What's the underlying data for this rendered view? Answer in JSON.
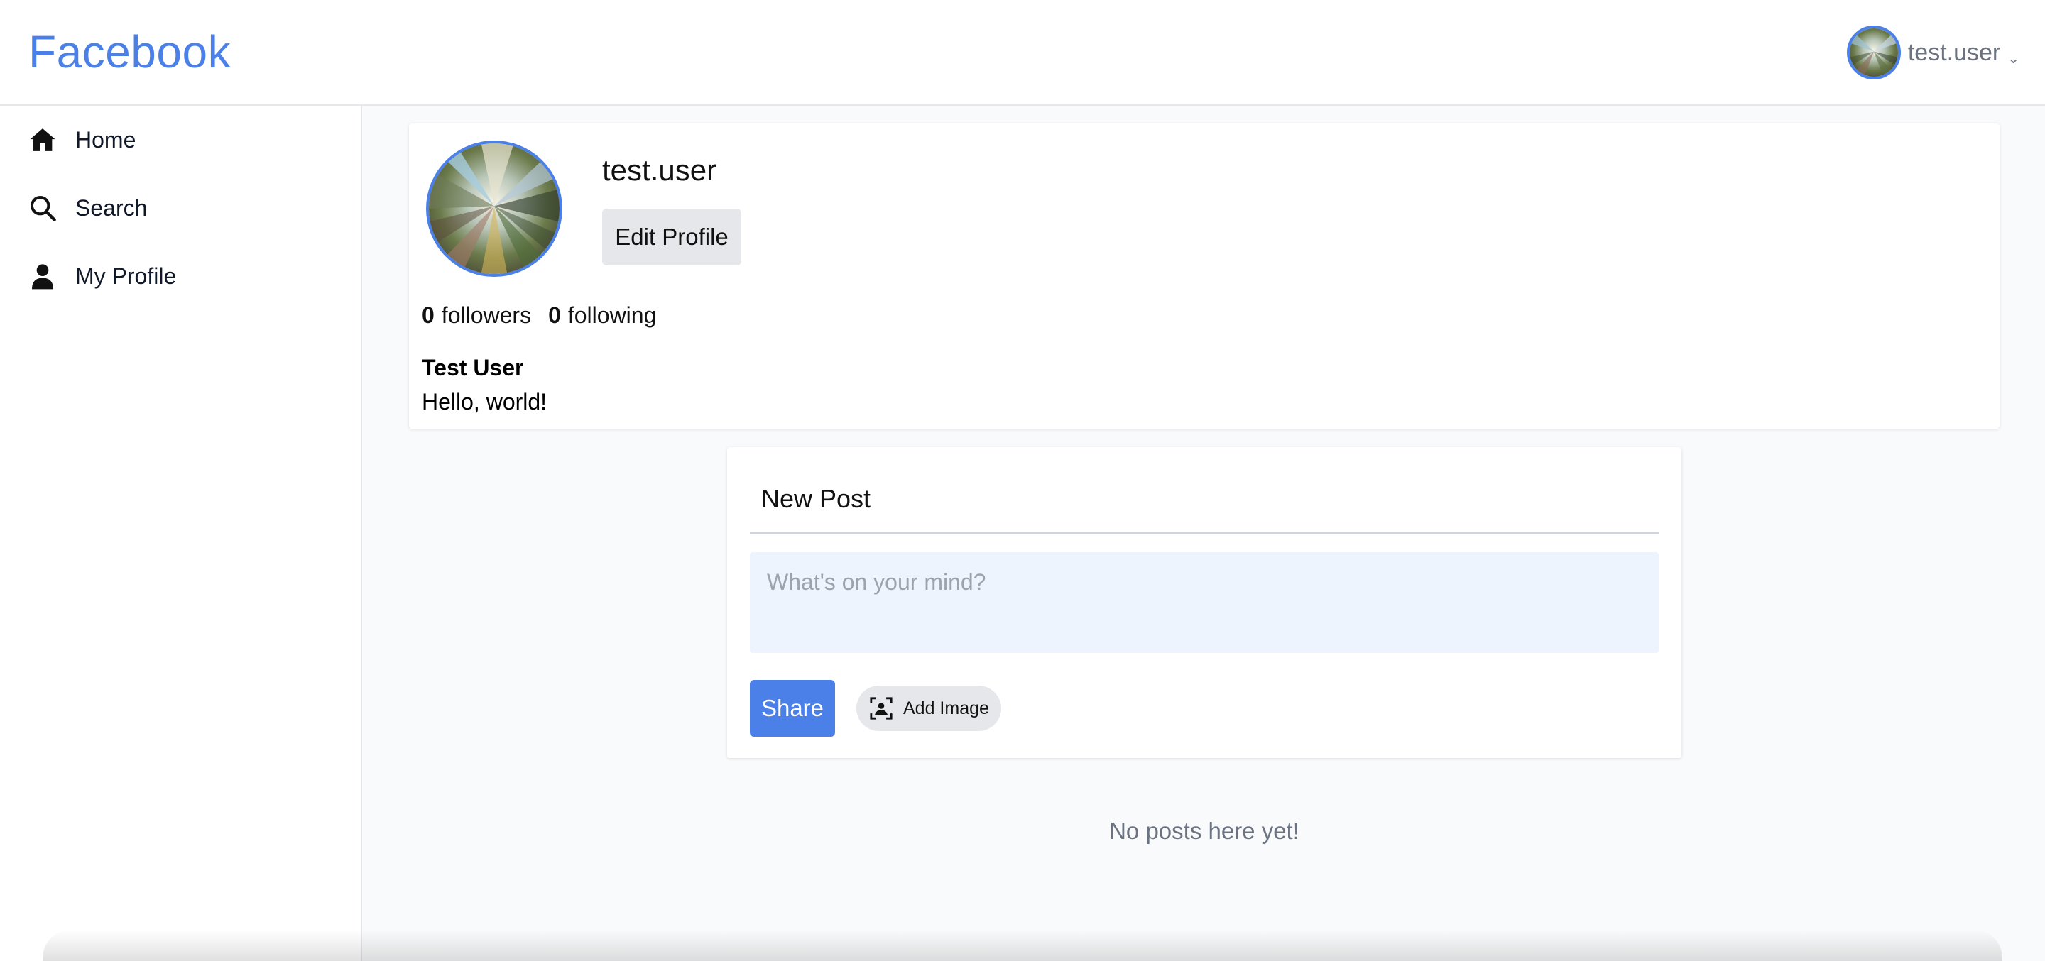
{
  "header": {
    "brand": "Facebook",
    "user_menu": {
      "username": "test.user",
      "caret_icon": "chevron-down-icon"
    }
  },
  "sidebar": {
    "items": [
      {
        "label": "Home",
        "icon": "home-icon"
      },
      {
        "label": "Search",
        "icon": "search-icon"
      },
      {
        "label": "My Profile",
        "icon": "user-icon"
      }
    ]
  },
  "profile": {
    "username": "test.user",
    "edit_button": "Edit Profile",
    "followers_count": "0",
    "followers_label": "followers",
    "following_count": "0",
    "following_label": "following",
    "full_name": "Test User",
    "bio": "Hello, world!"
  },
  "new_post": {
    "title": "New Post",
    "placeholder": "What's on your mind?",
    "value": "",
    "share_button": "Share",
    "add_image_button": "Add Image",
    "add_image_icon": "image-icon"
  },
  "feed": {
    "empty_message": "No posts here yet!"
  },
  "colors": {
    "accent": "#4a80e8",
    "input_background": "#eef4fd",
    "muted_text": "#6b7280"
  }
}
